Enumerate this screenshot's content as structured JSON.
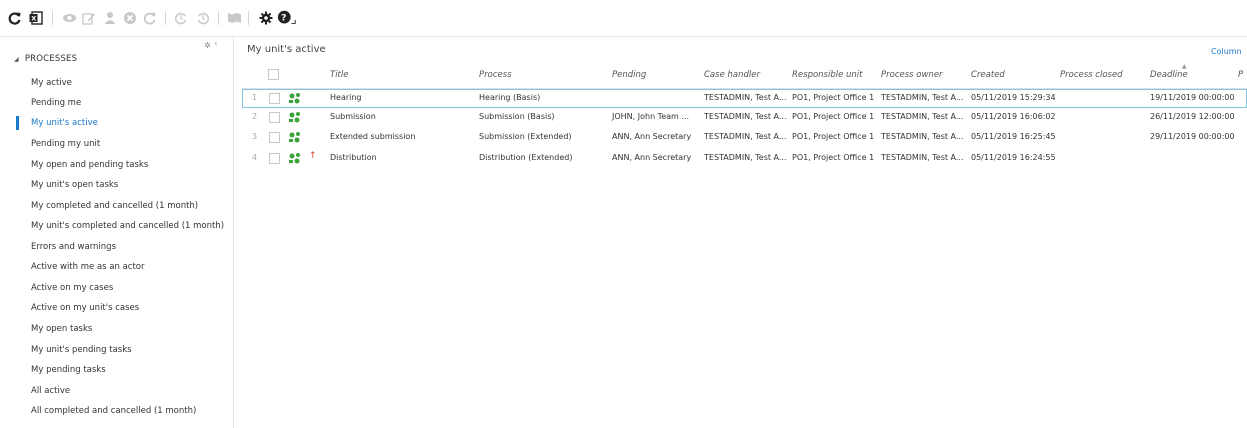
{
  "toolbar": {
    "buttons": [
      {
        "name": "refresh-icon",
        "enabled": true
      },
      {
        "name": "excel-export-icon",
        "enabled": true
      },
      {
        "name": "view-icon",
        "enabled": false
      },
      {
        "name": "edit-icon",
        "enabled": false
      },
      {
        "name": "user-icon",
        "enabled": false
      },
      {
        "name": "cancel-icon",
        "enabled": false
      },
      {
        "name": "restart-icon",
        "enabled": false
      },
      {
        "name": "timer-icon",
        "enabled": false
      },
      {
        "name": "history-icon",
        "enabled": false
      },
      {
        "name": "map-icon",
        "enabled": false
      },
      {
        "name": "settings-gear-icon",
        "enabled": true
      },
      {
        "name": "help-icon",
        "enabled": true
      }
    ]
  },
  "sidebar": {
    "header": "PROCESSES",
    "items": [
      {
        "label": "My active"
      },
      {
        "label": "Pending me"
      },
      {
        "label": "My unit's active",
        "active": true
      },
      {
        "label": "Pending my unit"
      },
      {
        "label": "My open and pending tasks"
      },
      {
        "label": "My unit's open tasks"
      },
      {
        "label": "My completed and cancelled (1 month)"
      },
      {
        "label": "My unit's completed and cancelled (1 month)"
      },
      {
        "label": "Errors and warnings"
      },
      {
        "label": "Active with me as an actor"
      },
      {
        "label": "Active on my cases"
      },
      {
        "label": "Active on my unit's cases"
      },
      {
        "label": "My open tasks"
      },
      {
        "label": "My unit's pending tasks"
      },
      {
        "label": "My pending tasks"
      },
      {
        "label": "All active"
      },
      {
        "label": "All completed and cancelled (1 month)"
      }
    ]
  },
  "main": {
    "title": "My unit's active",
    "column_link": "Column",
    "columns": [
      "Title",
      "Process",
      "Pending",
      "Case handler",
      "Responsible unit",
      "Process owner",
      "Created",
      "Process closed",
      "Deadline",
      "P"
    ],
    "rows": [
      {
        "num": "1",
        "title": "Hearing",
        "process": "Hearing (Basis)",
        "pending": "",
        "case_handler": "TESTADMIN, Test A...",
        "responsible_unit": "PO1, Project Office 1",
        "process_owner": "TESTADMIN, Test A...",
        "created": "05/11/2019 15:29:34",
        "process_closed": "",
        "deadline": "19/11/2019 00:00:00",
        "priority_up": false
      },
      {
        "num": "2",
        "title": "Submission",
        "process": "Submission (Basis)",
        "pending": "JOHN, John Team ...",
        "case_handler": "TESTADMIN, Test A...",
        "responsible_unit": "PO1, Project Office 1",
        "process_owner": "TESTADMIN, Test A...",
        "created": "05/11/2019 16:06:02",
        "process_closed": "",
        "deadline": "26/11/2019 12:00:00",
        "priority_up": false
      },
      {
        "num": "3",
        "title": "Extended submission",
        "process": "Submission (Extended)",
        "pending": "ANN, Ann Secretary",
        "case_handler": "TESTADMIN, Test A...",
        "responsible_unit": "PO1, Project Office 1",
        "process_owner": "TESTADMIN, Test A...",
        "created": "05/11/2019 16:25:45",
        "process_closed": "",
        "deadline": "29/11/2019 00:00:00",
        "priority_up": false
      },
      {
        "num": "4",
        "title": "Distribution",
        "process": "Distribution (Extended)",
        "pending": "ANN, Ann Secretary",
        "case_handler": "TESTADMIN, Test A...",
        "responsible_unit": "PO1, Project Office 1",
        "process_owner": "TESTADMIN, Test A...",
        "created": "05/11/2019 16:24:55",
        "process_closed": "",
        "deadline": "",
        "priority_up": true
      }
    ]
  },
  "colors": {
    "accent": "#1a78c8",
    "selected_border": "#7fc7e0",
    "process_icon": "#3aa33a",
    "priority_arrow": "#d6442a"
  }
}
